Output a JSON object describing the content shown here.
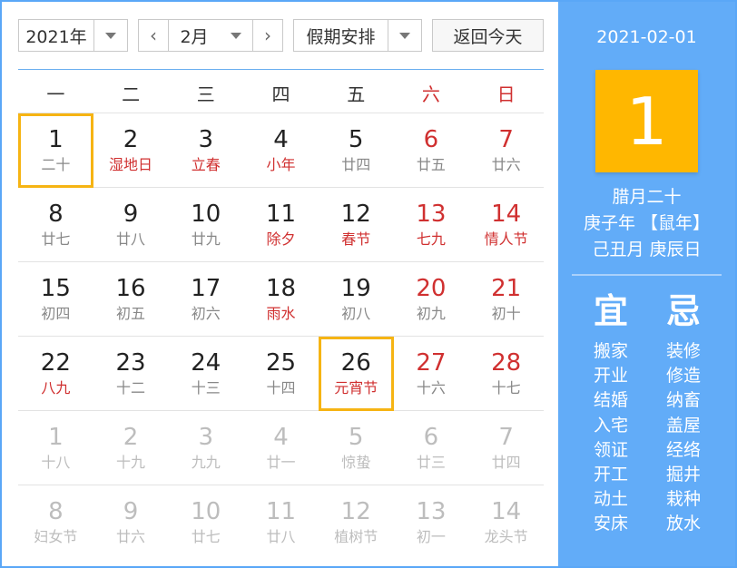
{
  "toolbar": {
    "year": "2021年",
    "month": "2月",
    "prev_symbol": "‹",
    "next_symbol": "›",
    "holiday": "假期安排",
    "today_label": "返回今天"
  },
  "weekdays": [
    "一",
    "二",
    "三",
    "四",
    "五",
    "六",
    "日"
  ],
  "days": [
    {
      "n": "1",
      "sub": "二十",
      "hol": false,
      "we": false,
      "other": false,
      "hl": true
    },
    {
      "n": "2",
      "sub": "湿地日",
      "hol": true,
      "we": false,
      "other": false,
      "hl": false
    },
    {
      "n": "3",
      "sub": "立春",
      "hol": true,
      "we": false,
      "other": false,
      "hl": false
    },
    {
      "n": "4",
      "sub": "小年",
      "hol": true,
      "we": false,
      "other": false,
      "hl": false
    },
    {
      "n": "5",
      "sub": "廿四",
      "hol": false,
      "we": false,
      "other": false,
      "hl": false
    },
    {
      "n": "6",
      "sub": "廿五",
      "hol": false,
      "we": true,
      "other": false,
      "hl": false
    },
    {
      "n": "7",
      "sub": "廿六",
      "hol": false,
      "we": true,
      "other": false,
      "hl": false
    },
    {
      "n": "8",
      "sub": "廿七",
      "hol": false,
      "we": false,
      "other": false,
      "hl": false
    },
    {
      "n": "9",
      "sub": "廿八",
      "hol": false,
      "we": false,
      "other": false,
      "hl": false
    },
    {
      "n": "10",
      "sub": "廿九",
      "hol": false,
      "we": false,
      "other": false,
      "hl": false
    },
    {
      "n": "11",
      "sub": "除夕",
      "hol": true,
      "we": false,
      "other": false,
      "hl": false
    },
    {
      "n": "12",
      "sub": "春节",
      "hol": true,
      "we": false,
      "other": false,
      "hl": false
    },
    {
      "n": "13",
      "sub": "七九",
      "hol": true,
      "we": true,
      "other": false,
      "hl": false
    },
    {
      "n": "14",
      "sub": "情人节",
      "hol": true,
      "we": true,
      "other": false,
      "hl": false
    },
    {
      "n": "15",
      "sub": "初四",
      "hol": false,
      "we": false,
      "other": false,
      "hl": false
    },
    {
      "n": "16",
      "sub": "初五",
      "hol": false,
      "we": false,
      "other": false,
      "hl": false
    },
    {
      "n": "17",
      "sub": "初六",
      "hol": false,
      "we": false,
      "other": false,
      "hl": false
    },
    {
      "n": "18",
      "sub": "雨水",
      "hol": true,
      "we": false,
      "other": false,
      "hl": false
    },
    {
      "n": "19",
      "sub": "初八",
      "hol": false,
      "we": false,
      "other": false,
      "hl": false
    },
    {
      "n": "20",
      "sub": "初九",
      "hol": false,
      "we": true,
      "other": false,
      "hl": false
    },
    {
      "n": "21",
      "sub": "初十",
      "hol": false,
      "we": true,
      "other": false,
      "hl": false
    },
    {
      "n": "22",
      "sub": "八九",
      "hol": true,
      "we": false,
      "other": false,
      "hl": false
    },
    {
      "n": "23",
      "sub": "十二",
      "hol": false,
      "we": false,
      "other": false,
      "hl": false
    },
    {
      "n": "24",
      "sub": "十三",
      "hol": false,
      "we": false,
      "other": false,
      "hl": false
    },
    {
      "n": "25",
      "sub": "十四",
      "hol": false,
      "we": false,
      "other": false,
      "hl": false
    },
    {
      "n": "26",
      "sub": "元宵节",
      "hol": true,
      "we": false,
      "other": false,
      "hl": true
    },
    {
      "n": "27",
      "sub": "十六",
      "hol": false,
      "we": true,
      "other": false,
      "hl": false
    },
    {
      "n": "28",
      "sub": "十七",
      "hol": false,
      "we": true,
      "other": false,
      "hl": false
    },
    {
      "n": "1",
      "sub": "十八",
      "hol": false,
      "we": false,
      "other": true,
      "hl": false
    },
    {
      "n": "2",
      "sub": "十九",
      "hol": false,
      "we": false,
      "other": true,
      "hl": false
    },
    {
      "n": "3",
      "sub": "九九",
      "hol": false,
      "we": false,
      "other": true,
      "hl": false
    },
    {
      "n": "4",
      "sub": "廿一",
      "hol": false,
      "we": false,
      "other": true,
      "hl": false
    },
    {
      "n": "5",
      "sub": "惊蛰",
      "hol": false,
      "we": false,
      "other": true,
      "hl": false
    },
    {
      "n": "6",
      "sub": "廿三",
      "hol": false,
      "we": true,
      "other": true,
      "hl": false
    },
    {
      "n": "7",
      "sub": "廿四",
      "hol": false,
      "we": true,
      "other": true,
      "hl": false
    },
    {
      "n": "8",
      "sub": "妇女节",
      "hol": false,
      "we": false,
      "other": true,
      "hl": false
    },
    {
      "n": "9",
      "sub": "廿六",
      "hol": false,
      "we": false,
      "other": true,
      "hl": false
    },
    {
      "n": "10",
      "sub": "廿七",
      "hol": false,
      "we": false,
      "other": true,
      "hl": false
    },
    {
      "n": "11",
      "sub": "廿八",
      "hol": false,
      "we": false,
      "other": true,
      "hl": false
    },
    {
      "n": "12",
      "sub": "植树节",
      "hol": false,
      "we": false,
      "other": true,
      "hl": false
    },
    {
      "n": "13",
      "sub": "初一",
      "hol": false,
      "we": true,
      "other": true,
      "hl": false
    },
    {
      "n": "14",
      "sub": "龙头节",
      "hol": false,
      "we": true,
      "other": true,
      "hl": false
    }
  ],
  "panel": {
    "date": "2021-02-01",
    "day": "1",
    "lunar_lines": [
      "腊月二十",
      "庚子年 【鼠年】",
      "己丑月 庚辰日"
    ],
    "yi_title": "宜",
    "ji_title": "忌",
    "yi": [
      "搬家",
      "开业",
      "结婚",
      "入宅",
      "领证",
      "开工",
      "动土",
      "安床"
    ],
    "ji": [
      "装修",
      "修造",
      "纳畜",
      "盖屋",
      "经络",
      "掘井",
      "栽种",
      "放水"
    ]
  },
  "colors": {
    "accent_blue": "#62acf8",
    "highlight_orange": "#f6b413",
    "holiday_red": "#d03030"
  }
}
